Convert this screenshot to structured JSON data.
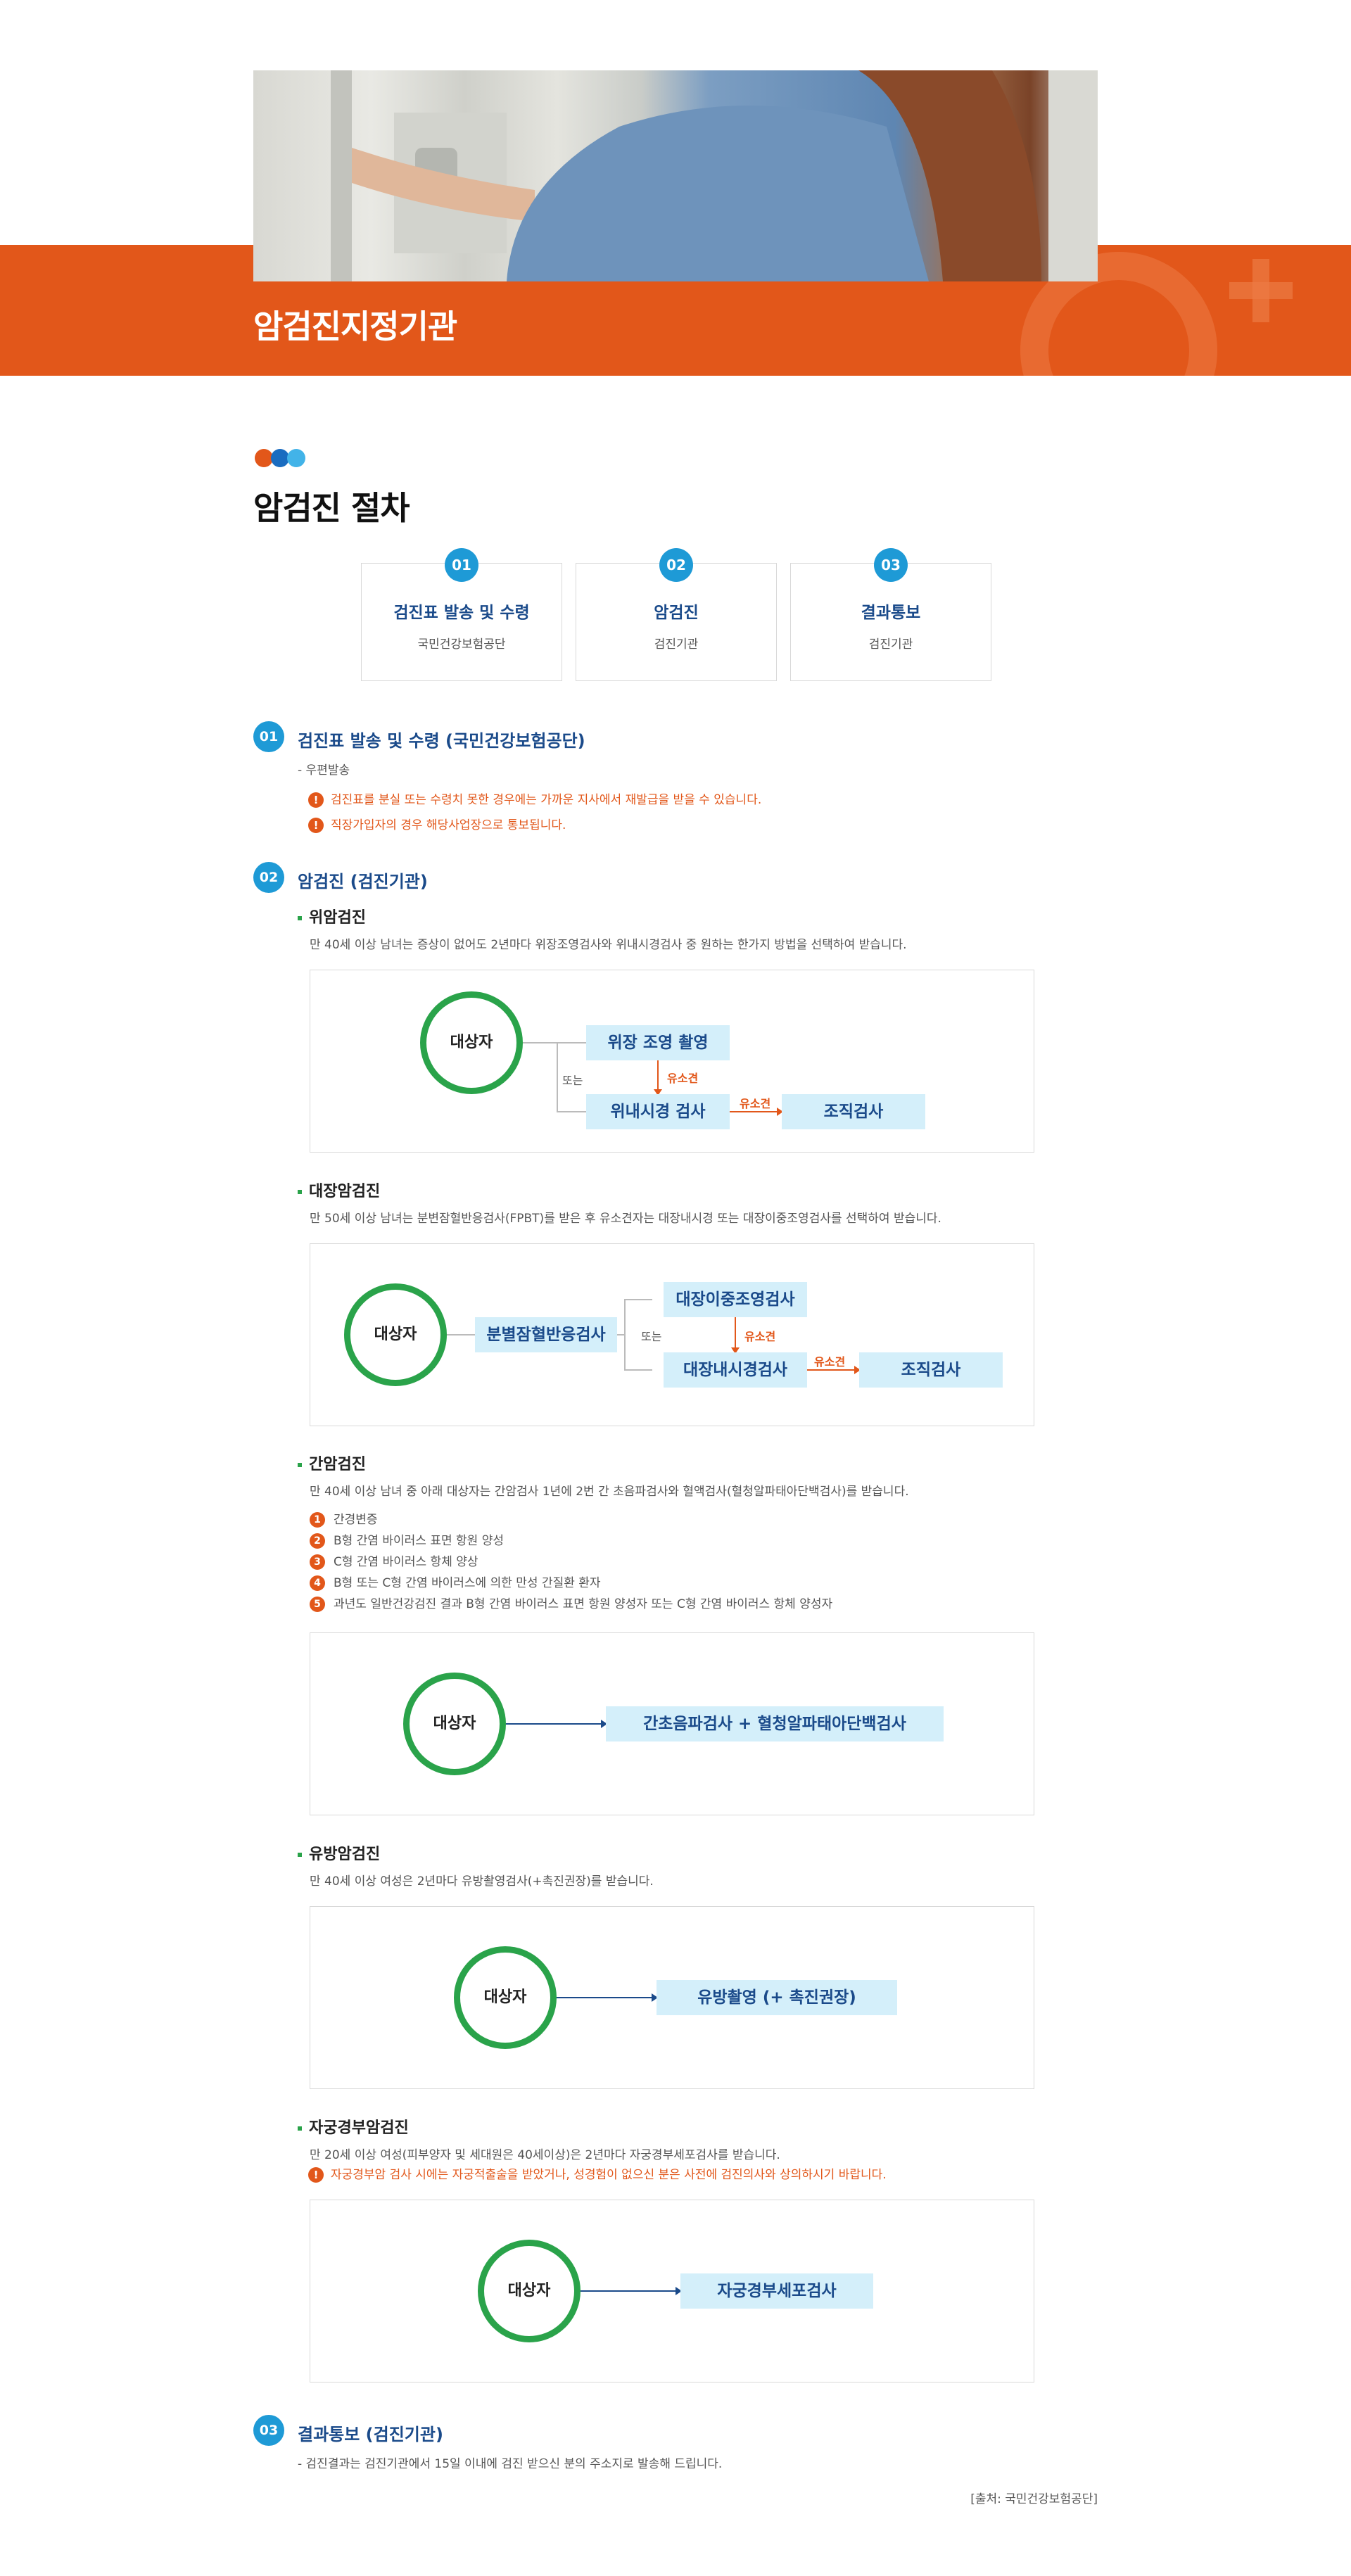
{
  "hero": {
    "title": "암검진지정기관"
  },
  "section": {
    "title": "암검진 절차"
  },
  "steps": [
    {
      "num": "01",
      "title": "검진표 발송 및 수령",
      "sub": "국민건강보험공단"
    },
    {
      "num": "02",
      "title": "암검진",
      "sub": "검진기관"
    },
    {
      "num": "03",
      "title": "결과통보",
      "sub": "검진기관"
    }
  ],
  "phase1": {
    "num": "01",
    "title": "검진표 발송 및 수령 (국민건강보험공단)",
    "desc": "- 우편발송",
    "warn_icon": "!",
    "warnings": [
      "검진표를 분실 또는 수령치 못한 경우에는 가까운 지사에서 재발급을 받을 수 있습니다.",
      "직장가입자의 경우 해당사업장으로 통보됩니다."
    ]
  },
  "phase2": {
    "num": "02",
    "title": "암검진 (검진기관)",
    "stomach": {
      "title": "위암검진",
      "desc": "만 40세 이상 남녀는 증상이 없어도 2년마다 위장조영검사와 위내시경검사 중 원하는 한가지 방법을 선택하여 받습니다.",
      "target": "대상자",
      "box1": "위장 조영 촬영",
      "box2": "위내시경 검사",
      "box3": "조직검사",
      "or": "또는",
      "positive": "유소견"
    },
    "colon": {
      "title": "대장암검진",
      "desc": "만 50세 이상 남녀는 분변잠혈반응검사(FPBT)를 받은 후 유소견자는 대장내시경 또는 대장이중조영검사를 선택하여 받습니다.",
      "target": "대상자",
      "box0": "분별잠혈반응검사",
      "box1": "대장이중조영검사",
      "box2": "대장내시경검사",
      "box3": "조직검사",
      "or": "또는",
      "positive": "유소견"
    },
    "liver": {
      "title": "간암검진",
      "desc": "만 40세 이상 남녀 중 아래 대상자는 간암검사 1년에 2번 간 초음파검사와 혈액검사(혈청알파태아단백검사)를 받습니다.",
      "items": [
        {
          "n": "1",
          "text": "간경변증"
        },
        {
          "n": "2",
          "text": "B형 간염 바이러스 표면 항원 양성"
        },
        {
          "n": "3",
          "text": "C형 간염 바이러스 항체 양상"
        },
        {
          "n": "4",
          "text": "B형 또는 C형 간염 바이러스에 의한 만성 간질환 환자"
        },
        {
          "n": "5",
          "text": "과년도 일반건강검진 결과 B형 간염 바이러스 표면 항원 양성자 또는 C형 간염 바이러스 항체 양성자"
        }
      ],
      "target": "대상자",
      "box": "간초음파검사 + 혈청알파태아단백검사"
    },
    "breast": {
      "title": "유방암검진",
      "desc": "만 40세 이상 여성은 2년마다 유방촬영검사(+촉진권장)를 받습니다.",
      "target": "대상자",
      "box": "유방촬영 (+ 촉진권장)"
    },
    "cervix": {
      "title": "자궁경부암검진",
      "desc": "만 20세 이상 여성(피부양자 및 세대원은 40세이상)은 2년마다 자궁경부세포검사를 받습니다.",
      "warning": "자궁경부암 검사 시에는 자궁적출술을 받았거나, 성경험이 없으신 분은 사전에 검진의사와 상의하시기 바랍니다.",
      "target": "대상자",
      "box": "자궁경부세포검사"
    }
  },
  "phase3": {
    "num": "03",
    "title": "결과통보 (검진기관)",
    "desc": "- 검진결과는 검진기관에서 15일 이내에 검진 받으신 분의 주소지로 발송해 드립니다."
  },
  "source": "[출처: 국민건강보험공단]",
  "colors": {
    "brand": "#e2571a",
    "accent_blue": "#1e9ad6",
    "navy": "#1a4a8a",
    "green": "#2aa34a",
    "box_bg": "#d4effa"
  }
}
